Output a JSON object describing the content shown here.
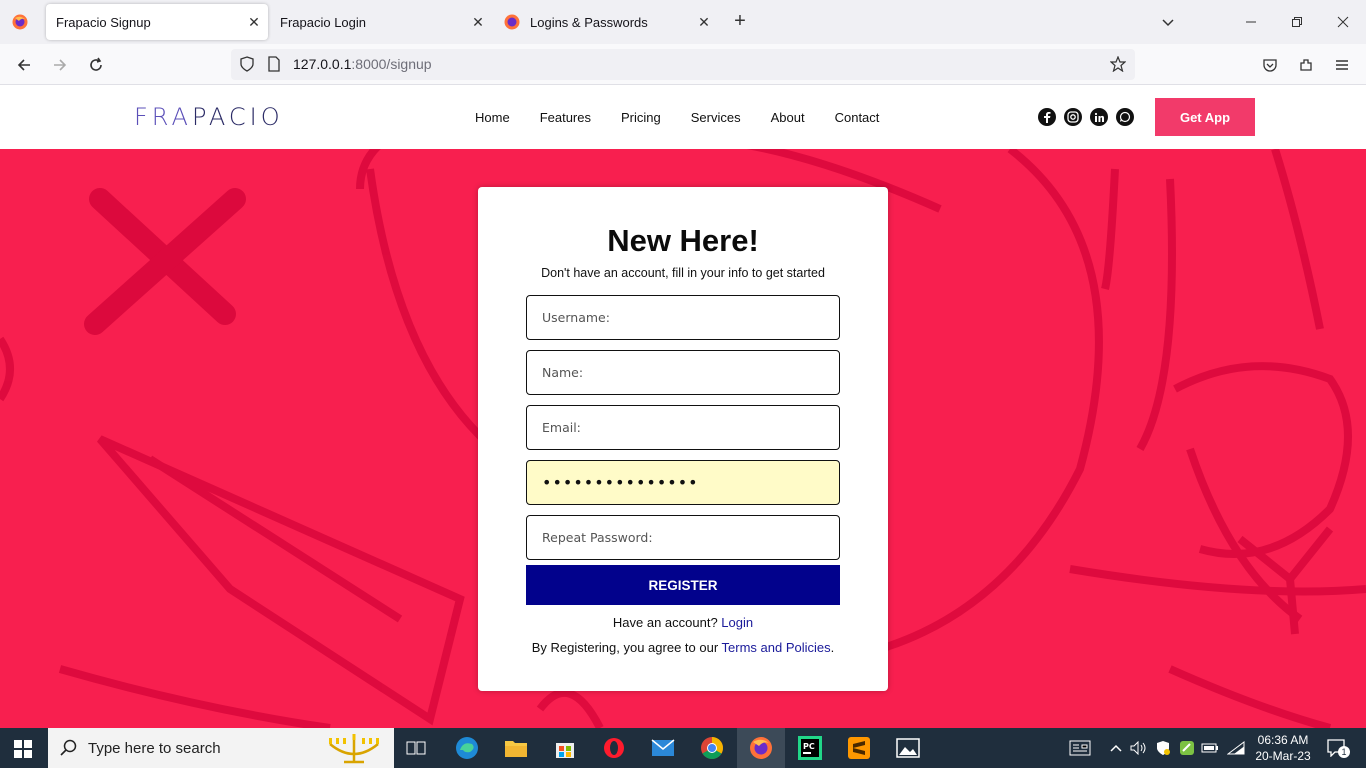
{
  "browser": {
    "tabs": [
      {
        "title": "Frapacio Signup",
        "active": true
      },
      {
        "title": "Frapacio Login",
        "active": false
      },
      {
        "title": "Logins & Passwords",
        "active": false
      }
    ],
    "url_host": "127.0.0.1",
    "url_rest": ":8000/signup"
  },
  "site": {
    "logo_part1": "FRA",
    "logo_part2": "PACIO",
    "menu": [
      "Home",
      "Features",
      "Pricing",
      "Services",
      "About",
      "Contact"
    ],
    "socials": [
      "facebook-icon",
      "instagram-icon",
      "linkedin-icon",
      "whatsapp-icon"
    ],
    "get_app": "Get App",
    "accent_color": "#f23a6a",
    "hero_color": "#f81f4f"
  },
  "signup": {
    "title": "New Here!",
    "subtitle": "Don't have an account, fill in your info to get started",
    "username_placeholder": "Username:",
    "name_placeholder": "Name:",
    "email_placeholder": "Email:",
    "password_value": "•••••••••••••••",
    "repeat_placeholder": "Repeat Password:",
    "register_label": "REGISTER",
    "have_account_text": "Have an account?",
    "login_link": "Login",
    "terms_prefix": "By Registering, you agree to our",
    "terms_link": "Terms and Policies",
    "terms_suffix": ".",
    "register_color": "#02028c"
  },
  "taskbar": {
    "search_placeholder": "Type here to search",
    "time": "06:36 AM",
    "date": "20-Mar-23",
    "notification_count": "1"
  }
}
